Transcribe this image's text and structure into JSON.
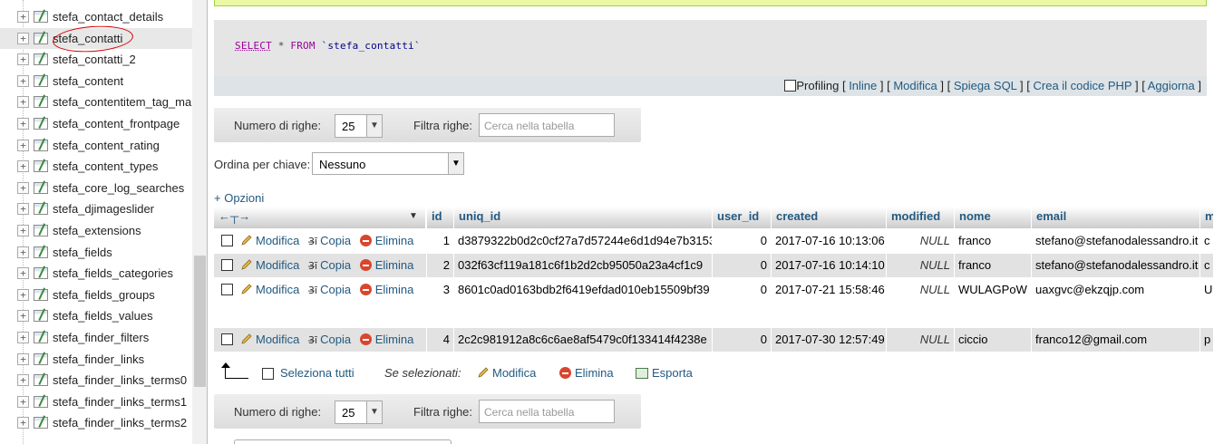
{
  "nav": {
    "items": [
      "stefa_contact_details",
      "stefa_contatti",
      "stefa_contatti_2",
      "stefa_content",
      "stefa_contentitem_tag_ma",
      "stefa_content_frontpage",
      "stefa_content_rating",
      "stefa_content_types",
      "stefa_core_log_searches",
      "stefa_djimageslider",
      "stefa_extensions",
      "stefa_fields",
      "stefa_fields_categories",
      "stefa_fields_groups",
      "stefa_fields_values",
      "stefa_finder_filters",
      "stefa_finder_links",
      "stefa_finder_links_terms0",
      "stefa_finder_links_terms1",
      "stefa_finder_links_terms2"
    ],
    "selected": "stefa_contatti"
  },
  "sql": {
    "kw_select": "SELECT",
    "star": " * ",
    "kw_from": "FROM",
    "table": " `stefa_contatti`"
  },
  "sql_links": {
    "profiling": "Profiling",
    "inline": "Inline",
    "modifica": "Modifica",
    "spiega": "Spiega SQL",
    "php": "Crea il codice PHP",
    "aggiorna": "Aggiorna"
  },
  "paging": {
    "rows_label": "Numero di righe:",
    "rows_value": "25",
    "filter_label": "Filtra righe:",
    "filter_placeholder": "Cerca nella tabella"
  },
  "order": {
    "label": "Ordina per chiave:",
    "value": "Nessuno"
  },
  "options_label": "+ Opzioni",
  "table": {
    "columns": [
      "id",
      "uniq_id",
      "user_id",
      "created",
      "modified",
      "nome",
      "email",
      "m"
    ],
    "action_labels": {
      "edit": "Modifica",
      "copy": "Copia",
      "delete": "Elimina"
    },
    "rows": [
      {
        "id": "1",
        "uniq_id": "d3879322b0d2c0cf27a7d57244e6d1d94e7b3153",
        "user_id": "0",
        "created": "2017-07-16 10:13:06",
        "modified": "NULL",
        "nome": "franco",
        "email": "stefano@stefanodalessandro.it",
        "m": "c"
      },
      {
        "id": "2",
        "uniq_id": "032f63cf119a181c6f1b2d2cb95050a23a4cf1c9",
        "user_id": "0",
        "created": "2017-07-16 10:14:10",
        "modified": "NULL",
        "nome": "franco",
        "email": "stefano@stefanodalessandro.it",
        "m": "c"
      },
      {
        "id": "3",
        "uniq_id": "8601c0ad0163bdb2f6419efdad010eb15509bf39",
        "user_id": "0",
        "created": "2017-07-21 15:58:46",
        "modified": "NULL",
        "nome": "WULAGPoW",
        "email": "uaxgvc@ekzqjp.com",
        "m": "U"
      },
      {
        "id": "4",
        "uniq_id": "2c2c981912a8c6c6ae8af5479c0f133414f4238e",
        "user_id": "0",
        "created": "2017-07-30 12:57:49",
        "modified": "NULL",
        "nome": "ciccio",
        "email": "franco12@gmail.com",
        "m": "p"
      }
    ]
  },
  "bulk": {
    "select_all": "Seleziona tutti",
    "if_selected": "Se selezionati:",
    "edit": "Modifica",
    "delete": "Elimina",
    "export": "Esporta"
  }
}
